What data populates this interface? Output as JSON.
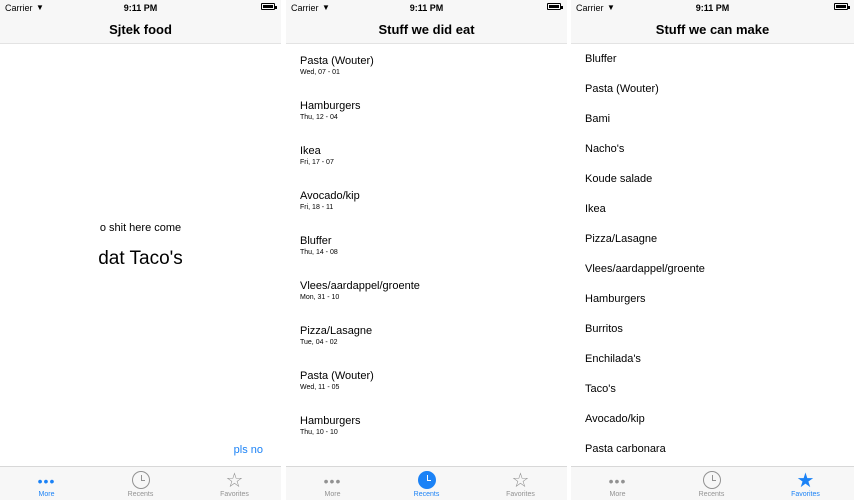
{
  "status": {
    "carrier": "Carrier",
    "time": "9:11 PM"
  },
  "screen1": {
    "title": "Sjtek food",
    "subtitle": "o shit here come",
    "headline": "dat Taco's",
    "link": "pls no"
  },
  "screen2": {
    "title": "Stuff we did eat",
    "items": [
      {
        "name": "Pasta (Wouter)",
        "date": "Wed, 07 - 01"
      },
      {
        "name": "Hamburgers",
        "date": "Thu, 12 - 04"
      },
      {
        "name": "Ikea",
        "date": "Fri, 17 - 07"
      },
      {
        "name": "Avocado/kip",
        "date": "Fri, 18 - 11"
      },
      {
        "name": "Bluffer",
        "date": "Thu, 14 - 08"
      },
      {
        "name": "Vlees/aardappel/groente",
        "date": "Mon, 31 - 10"
      },
      {
        "name": "Pizza/Lasagne",
        "date": "Tue, 04 - 02"
      },
      {
        "name": "Pasta (Wouter)",
        "date": "Wed, 11 - 05"
      },
      {
        "name": "Hamburgers",
        "date": "Thu, 10 - 10"
      }
    ]
  },
  "screen3": {
    "title": "Stuff we can make",
    "items": [
      "Bluffer",
      "Pasta (Wouter)",
      "Bami",
      "Nacho's",
      "Koude salade",
      "Ikea",
      "Pizza/Lasagne",
      "Vlees/aardappel/groente",
      "Hamburgers",
      "Burritos",
      "Enchilada's",
      "Taco's",
      "Avocado/kip",
      "Pasta carbonara"
    ]
  },
  "tabs": {
    "more": "More",
    "recents": "Recents",
    "favorites": "Favorites"
  },
  "colors": {
    "accent": "#1b82f6",
    "inactive": "#929292",
    "bar": "#f7f7f7"
  }
}
